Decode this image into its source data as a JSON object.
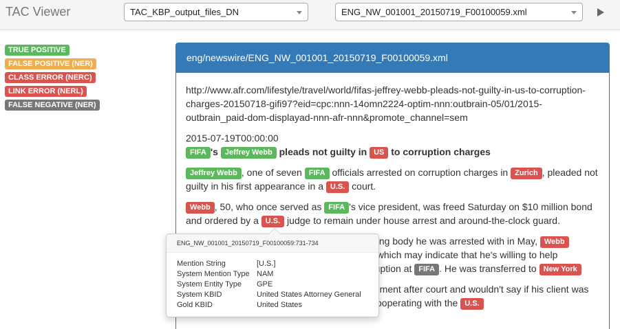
{
  "header": {
    "title": "TAC Viewer",
    "directory_select": "TAC_KBP_output_files_DN",
    "file_select": "ENG_NW_001001_20150719_F00100059.xml"
  },
  "legend": [
    {
      "label": "TRUE POSITIVE",
      "color": "#5cb85c"
    },
    {
      "label": "FALSE POSITIVE (NER)",
      "color": "#f0ad4e"
    },
    {
      "label": "CLASS ERROR (NERC)",
      "color": "#d9534f"
    },
    {
      "label": "LINK ERROR (NERL)",
      "color": "#d9534f"
    },
    {
      "label": "FALSE NEGATIVE (NER)",
      "color": "#777777"
    }
  ],
  "document": {
    "path": "eng/newswire/ENG_NW_001001_20150719_F00100059.xml",
    "url": "http://www.afr.com/lifestyle/travel/world/fifas-jeffrey-webb-pleads-not-guilty-in-us-to-corruption-charges-20150718-gifi97?eid=cpc:nnn-14omn2224-optim-nnn:outbrain-05/01/2015-outbrain_paid-dom-displayad-nnn-afr-nnn&promote_channel=sem",
    "date": "2015-07-19T00:00:00",
    "headline": {
      "m1": "FIFA",
      "t1": "'s ",
      "m2": "Jeffrey Webb",
      "t2": " pleads not guilty in ",
      "m3": "US",
      "t3": " to corruption charges"
    },
    "p1": {
      "m1": "Jeffrey Webb",
      "t1": ", one of seven ",
      "m2": "FIFA",
      "t2": " officials arrested on corruption charges in ",
      "m3": "Zurich",
      "t3": ", pleaded not guilty in his first appearance in a ",
      "m4": "U.S.",
      "t4": " court."
    },
    "p2": {
      "m1": "Webb",
      "t1": ", 50, who once served as ",
      "m2": "FIFA",
      "t2": "'s vice president, was freed Saturday on $10 million bond and ordered by a ",
      "m3": "U.S.",
      "t3": " judge to remain under house arrest and around-the-clock guard."
    },
    "p3": {
      "t1": "ning body he was arrested with in May, ",
      "m1": "Webb",
      "t2": ", which may indicate that he's willing to help",
      "t3": "ruption at ",
      "m2": "FIFA",
      "t4": ". He was transferred to ",
      "m3": "New York"
    },
    "p4": {
      "t1": "mment after court and wouldn't say if his client was",
      "t2": "cooperating with the ",
      "m1": "U.S."
    }
  },
  "popover": {
    "title": "ENG_NW_001001_20150719_F00100059:731-734",
    "rows": [
      {
        "key": "Mention String",
        "value": "[U.S.]"
      },
      {
        "key": "System Mention Type",
        "value": "NAM"
      },
      {
        "key": "System Entity Type",
        "value": "GPE"
      },
      {
        "key": "System KBID",
        "value": "United States Attorney General"
      },
      {
        "key": "Gold KBID",
        "value": "United States"
      }
    ]
  }
}
